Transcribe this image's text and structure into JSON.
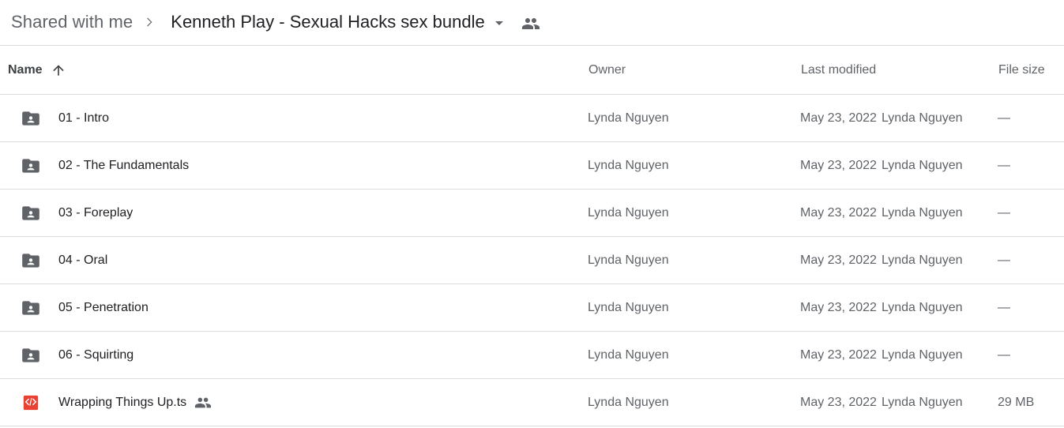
{
  "breadcrumb": {
    "parent": "Shared with me",
    "current": "Kenneth Play - Sexual Hacks sex bundle",
    "separator_icon": "chevron-right-icon",
    "dropdown_icon": "caret-down-icon",
    "shared_icon": "people-icon"
  },
  "columns": {
    "name": "Name",
    "owner": "Owner",
    "last_modified": "Last modified",
    "file_size": "File size",
    "sort_icon": "arrow-up-icon"
  },
  "rows": [
    {
      "type": "shared-folder",
      "icon": "shared-folder-icon",
      "name": "01 - Intro",
      "owner": "Lynda Nguyen",
      "modified_date": "May 23, 2022",
      "modified_by": "Lynda Nguyen",
      "size": "—",
      "shared": false
    },
    {
      "type": "shared-folder",
      "icon": "shared-folder-icon",
      "name": "02 - The Fundamentals",
      "owner": "Lynda Nguyen",
      "modified_date": "May 23, 2022",
      "modified_by": "Lynda Nguyen",
      "size": "—",
      "shared": false
    },
    {
      "type": "shared-folder",
      "icon": "shared-folder-icon",
      "name": "03 - Foreplay",
      "owner": "Lynda Nguyen",
      "modified_date": "May 23, 2022",
      "modified_by": "Lynda Nguyen",
      "size": "—",
      "shared": false
    },
    {
      "type": "shared-folder",
      "icon": "shared-folder-icon",
      "name": "04 - Oral",
      "owner": "Lynda Nguyen",
      "modified_date": "May 23, 2022",
      "modified_by": "Lynda Nguyen",
      "size": "—",
      "shared": false
    },
    {
      "type": "shared-folder",
      "icon": "shared-folder-icon",
      "name": "05 - Penetration",
      "owner": "Lynda Nguyen",
      "modified_date": "May 23, 2022",
      "modified_by": "Lynda Nguyen",
      "size": "—",
      "shared": false
    },
    {
      "type": "shared-folder",
      "icon": "shared-folder-icon",
      "name": "06 - Squirting",
      "owner": "Lynda Nguyen",
      "modified_date": "May 23, 2022",
      "modified_by": "Lynda Nguyen",
      "size": "—",
      "shared": false
    },
    {
      "type": "code-file",
      "icon": "code-file-icon",
      "name": "Wrapping Things Up.ts",
      "owner": "Lynda Nguyen",
      "modified_date": "May 23, 2022",
      "modified_by": "Lynda Nguyen",
      "size": "29 MB",
      "shared": true
    }
  ],
  "colors": {
    "folder": "#5f6368",
    "code_file": "#e94235",
    "divider": "#dadce0"
  }
}
